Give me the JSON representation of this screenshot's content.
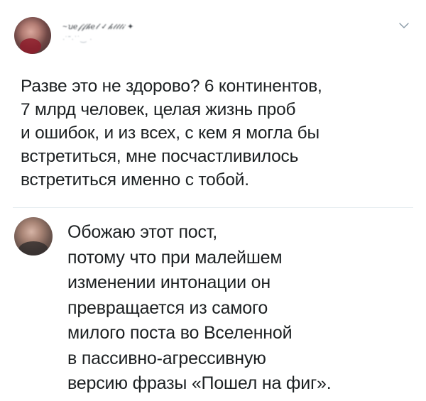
{
  "tweet": {
    "author_name_blurred": "~ꭒℯ𝒻𝒻𝒽ℯ𝓁 ✓𝒽𝓉𝓉𝓉𝒾 ✦",
    "author_handle_blurred": "·͘ ˜·ˈ˙‿ ·",
    "menu_icon": "chevron-down-icon",
    "lines": [
      "Разве это не здорово? 6 континентов,",
      "7 млрд человек, целая жизнь проб",
      "и ошибок, и из всех, с кем я могла бы",
      "встретиться, мне посчастливилось",
      "встретиться именно с тобой."
    ]
  },
  "reply": {
    "lines": [
      "Обожаю этот пост,",
      "потому что при малейшем",
      "изменении интонации он",
      "превращается из самого",
      "милого поста во Вселенной",
      "в пассивно-агрессивную",
      "версию фразы «Пошел на фиг»."
    ]
  },
  "colors": {
    "text": "#1c2022",
    "divider": "#e6ecf0",
    "icon": "#8899a6"
  }
}
